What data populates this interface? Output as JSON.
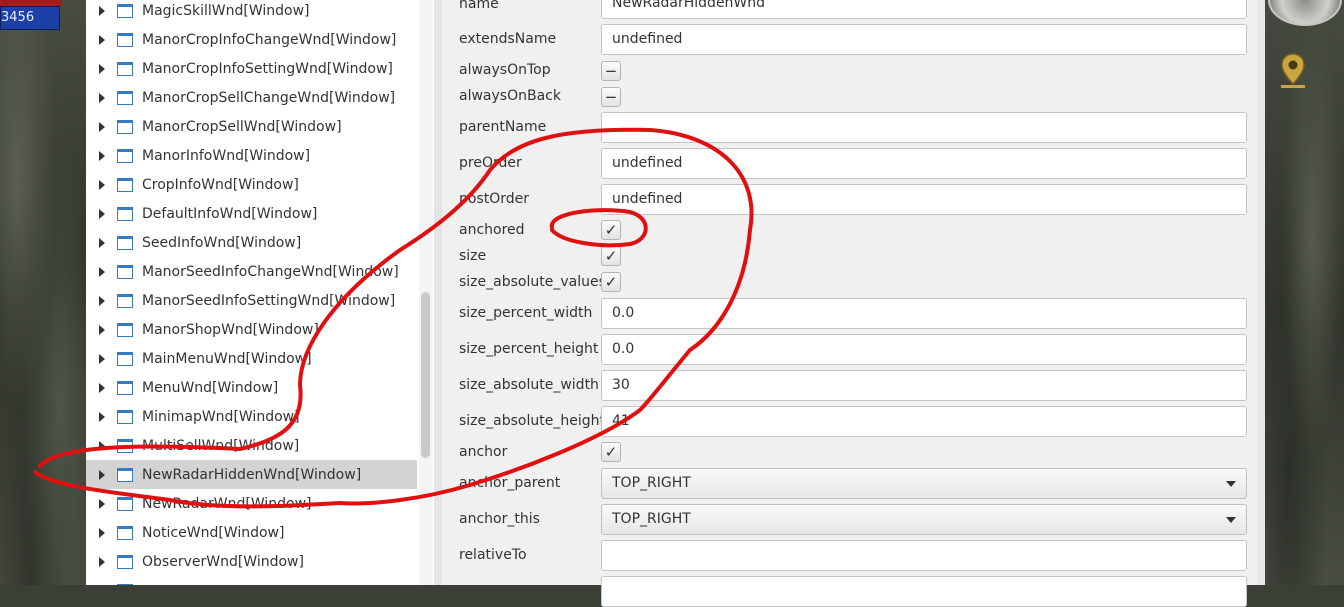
{
  "hud": {
    "hp_value": "3456"
  },
  "tree": {
    "items": [
      {
        "label": "MagicSkillWnd[Window]"
      },
      {
        "label": "ManorCropInfoChangeWnd[Window]"
      },
      {
        "label": "ManorCropInfoSettingWnd[Window]"
      },
      {
        "label": "ManorCropSellChangeWnd[Window]"
      },
      {
        "label": "ManorCropSellWnd[Window]"
      },
      {
        "label": "ManorInfoWnd[Window]"
      },
      {
        "label": "CropInfoWnd[Window]"
      },
      {
        "label": "DefaultInfoWnd[Window]"
      },
      {
        "label": "SeedInfoWnd[Window]"
      },
      {
        "label": "ManorSeedInfoChangeWnd[Window]"
      },
      {
        "label": "ManorSeedInfoSettingWnd[Window]"
      },
      {
        "label": "ManorShopWnd[Window]"
      },
      {
        "label": "MainMenuWnd[Window]"
      },
      {
        "label": "MenuWnd[Window]"
      },
      {
        "label": "MinimapWnd[Window]"
      },
      {
        "label": "MultiSellWnd[Window]"
      },
      {
        "label": "NewRadarHiddenWnd[Window]",
        "selected": true
      },
      {
        "label": "NewRadarWnd[Window]"
      },
      {
        "label": "NoticeWnd[Window]"
      },
      {
        "label": "ObserverWnd[Window]"
      }
    ]
  },
  "properties": {
    "name": {
      "label": "name",
      "value": "NewRadarHiddenWnd"
    },
    "extendsName": {
      "label": "extendsName",
      "value": "undefined"
    },
    "alwaysOnTop": {
      "label": "alwaysOnTop",
      "state": "−"
    },
    "alwaysOnBack": {
      "label": "alwaysOnBack",
      "state": "−"
    },
    "parentName": {
      "label": "parentName",
      "value": ""
    },
    "preOrder": {
      "label": "preOrder",
      "value": "undefined"
    },
    "postOrder": {
      "label": "postOrder",
      "value": "undefined"
    },
    "anchored": {
      "label": "anchored",
      "state": "✓"
    },
    "size": {
      "label": "size",
      "state": "✓"
    },
    "size_absolute_values": {
      "label": "size_absolute_values",
      "state": "✓"
    },
    "size_percent_width": {
      "label": "size_percent_width",
      "value": "0.0"
    },
    "size_percent_height": {
      "label": "size_percent_height",
      "value": "0.0"
    },
    "size_absolute_width": {
      "label": "size_absolute_width",
      "value": "30"
    },
    "size_absolute_height": {
      "label": "size_absolute_height",
      "value": "41"
    },
    "anchor": {
      "label": "anchor",
      "state": "✓"
    },
    "anchor_parent": {
      "label": "anchor_parent",
      "value": "TOP_RIGHT"
    },
    "anchor_this": {
      "label": "anchor_this",
      "value": "TOP_RIGHT"
    },
    "relativeTo": {
      "label": "relativeTo",
      "value": ""
    }
  },
  "colors": {
    "annotation": "#e01010",
    "selection": "#d3d3d3",
    "window_icon": "#3a7bbf"
  }
}
